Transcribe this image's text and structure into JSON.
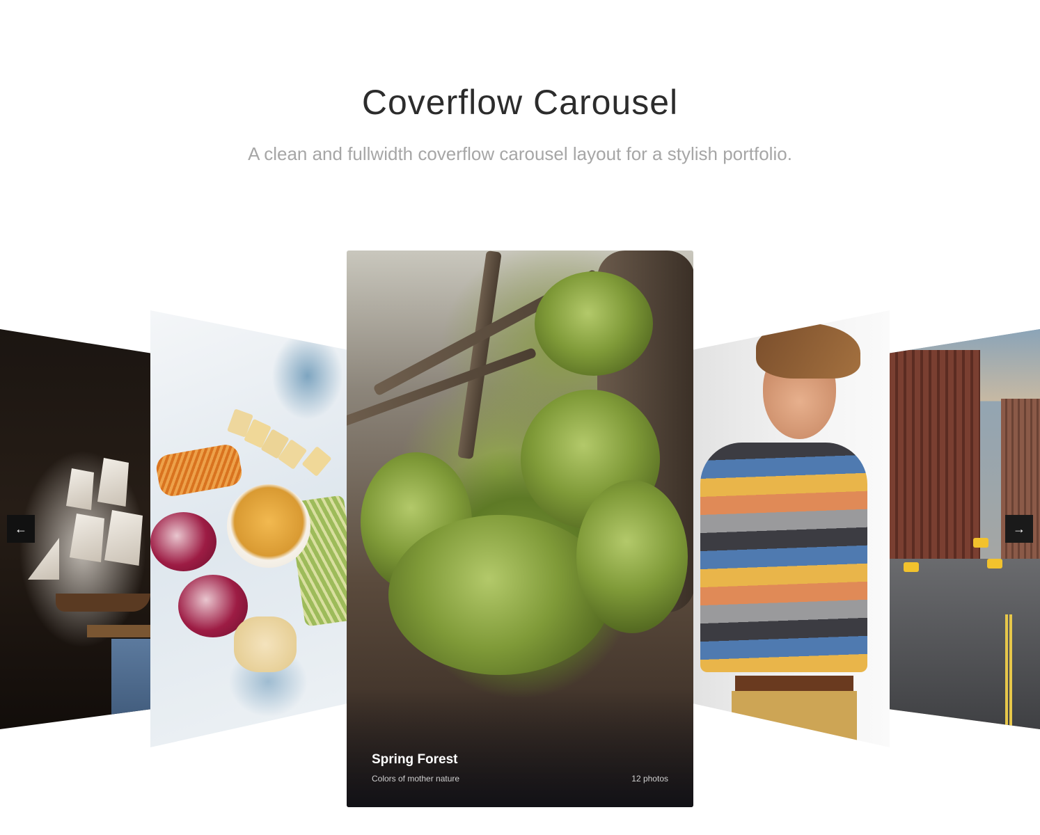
{
  "header": {
    "title": "Coverflow Carousel",
    "subtitle": "A clean and fullwidth coverflow carousel layout for a stylish portfolio."
  },
  "carousel": {
    "active_slide": {
      "title": "Spring Forest",
      "subtitle": "Colors of mother nature",
      "count": "12 photos"
    },
    "slides": [
      {
        "image": "ship-model-photo"
      },
      {
        "image": "food-platter-photo"
      },
      {
        "image": "spring-forest-moss-photo"
      },
      {
        "image": "man-striped-sweater-photo"
      },
      {
        "image": "city-street-photo"
      }
    ],
    "nav": {
      "prev_icon": "arrow-left-icon",
      "next_icon": "arrow-right-icon",
      "prev_glyph": "←",
      "next_glyph": "→"
    }
  },
  "colors": {
    "title": "#2c2c2c",
    "subtitle": "#a6a6a6",
    "nav_background": "#111111",
    "background": "#ffffff"
  }
}
